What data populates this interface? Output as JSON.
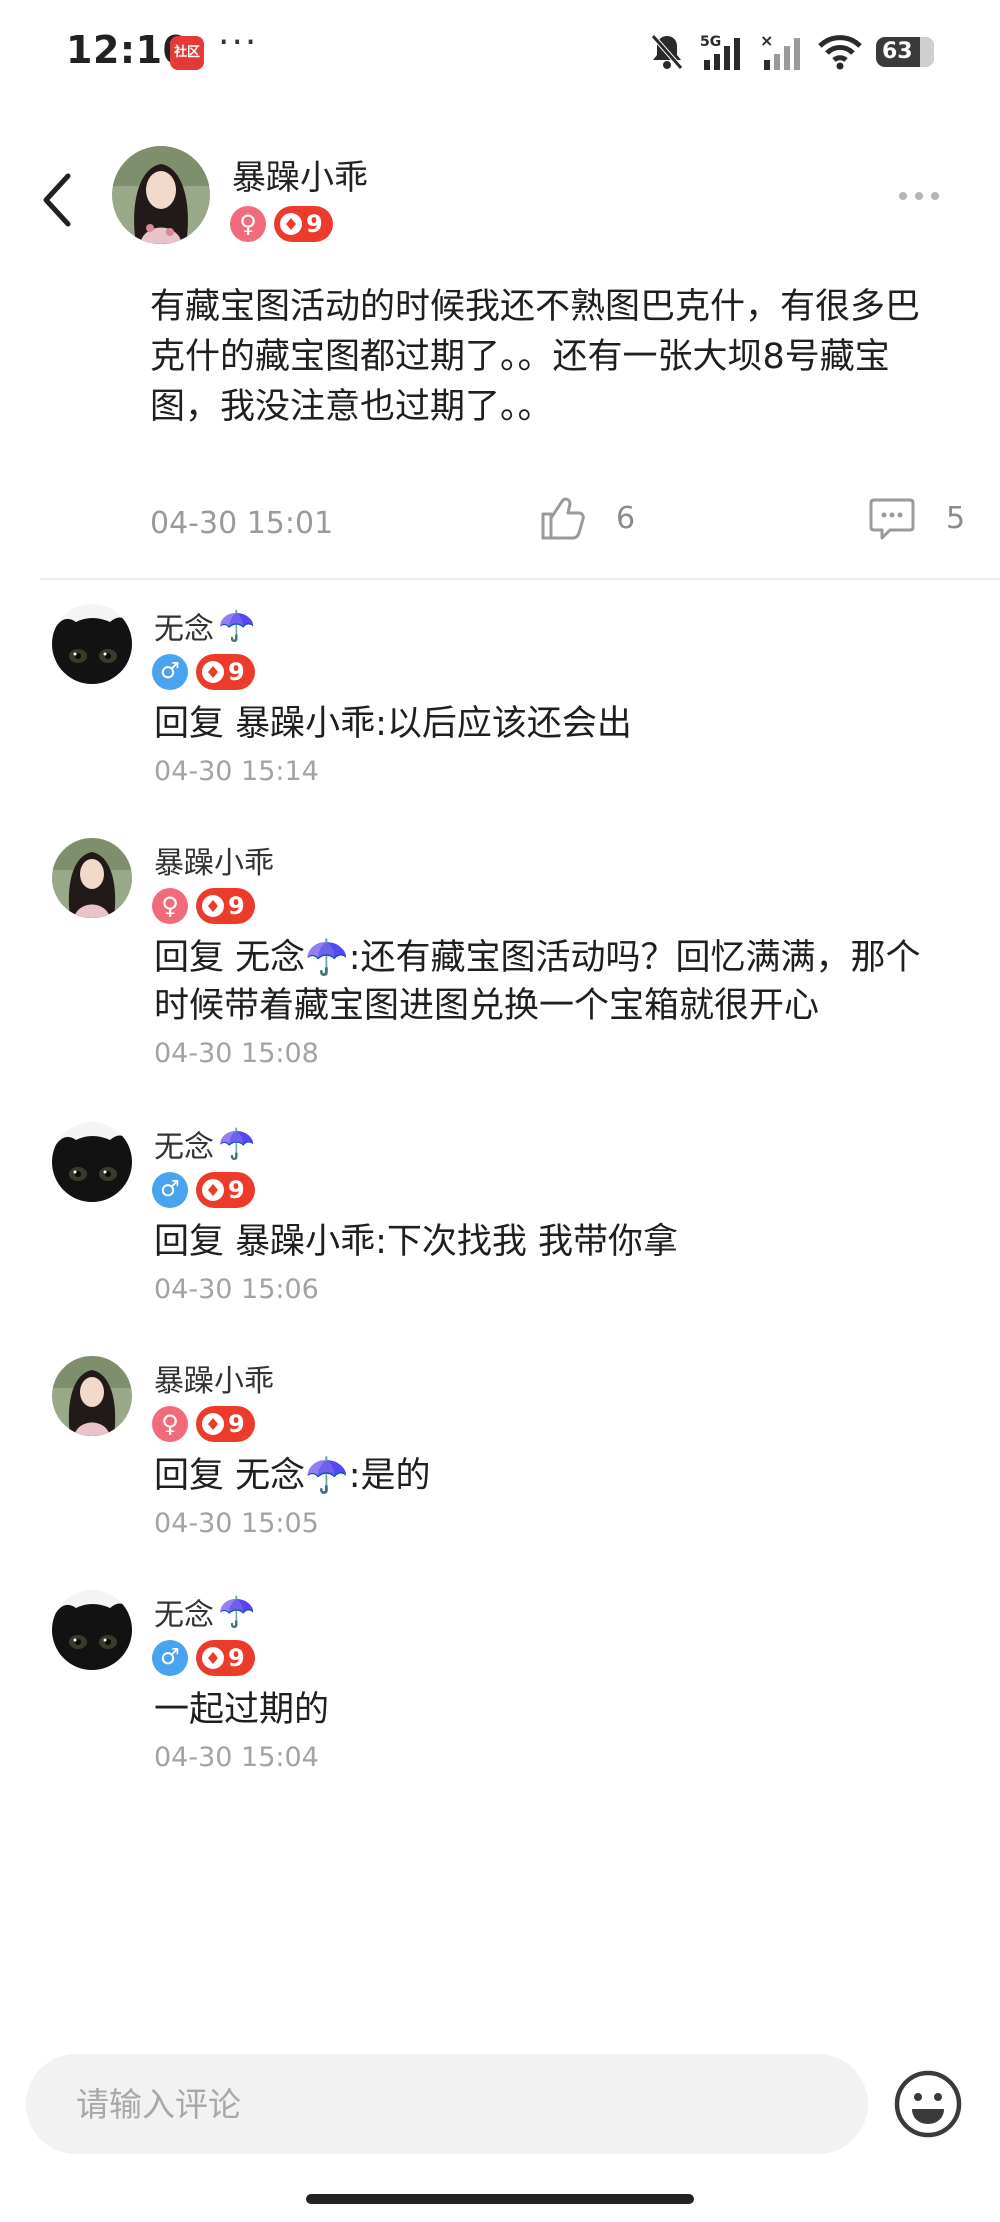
{
  "status_bar": {
    "time": "12:10",
    "app_badge": "社区",
    "overflow": "···",
    "network": "5G",
    "battery": "63"
  },
  "post": {
    "author": "暴躁小乖",
    "gender": "♀",
    "level": "9",
    "content": "有藏宝图活动的时候我还不熟图巴克什，有很多巴克什的藏宝图都过期了。。还有一张大坝8号藏宝图，我没注意也过期了。。",
    "time": "04-30 15:01",
    "likes": "6",
    "comments": "5"
  },
  "replies": [
    {
      "name": "无念",
      "name_emoji": "☂️",
      "gender": "♂",
      "level": "9",
      "text": "回复 暴躁小乖:以后应该还会出",
      "time": "04-30 15:14",
      "avatar": "black-cat"
    },
    {
      "name": "暴躁小乖",
      "name_emoji": "",
      "gender": "♀",
      "level": "9",
      "text": "回复 无念☂️:还有藏宝图活动吗？回忆满满，那个时候带着藏宝图进图兑换一个宝箱就很开心",
      "time": "04-30 15:08",
      "avatar": "girl"
    },
    {
      "name": "无念",
      "name_emoji": "☂️",
      "gender": "♂",
      "level": "9",
      "text": "回复 暴躁小乖:下次找我 我带你拿",
      "time": "04-30 15:06",
      "avatar": "black-cat"
    },
    {
      "name": "暴躁小乖",
      "name_emoji": "",
      "gender": "♀",
      "level": "9",
      "text": "回复 无念☂️:是的",
      "time": "04-30 15:05",
      "avatar": "girl"
    },
    {
      "name": "无念",
      "name_emoji": "☂️",
      "gender": "♂",
      "level": "9",
      "text": "一起过期的",
      "time": "04-30 15:04",
      "avatar": "black-cat"
    }
  ],
  "input": {
    "placeholder": "请输入评论"
  },
  "colors": {
    "level_badge": "#ec3b2b",
    "female_badge": "#f26b7a",
    "male_badge": "#4aa3ee",
    "muted_text": "#9a9a9a"
  }
}
